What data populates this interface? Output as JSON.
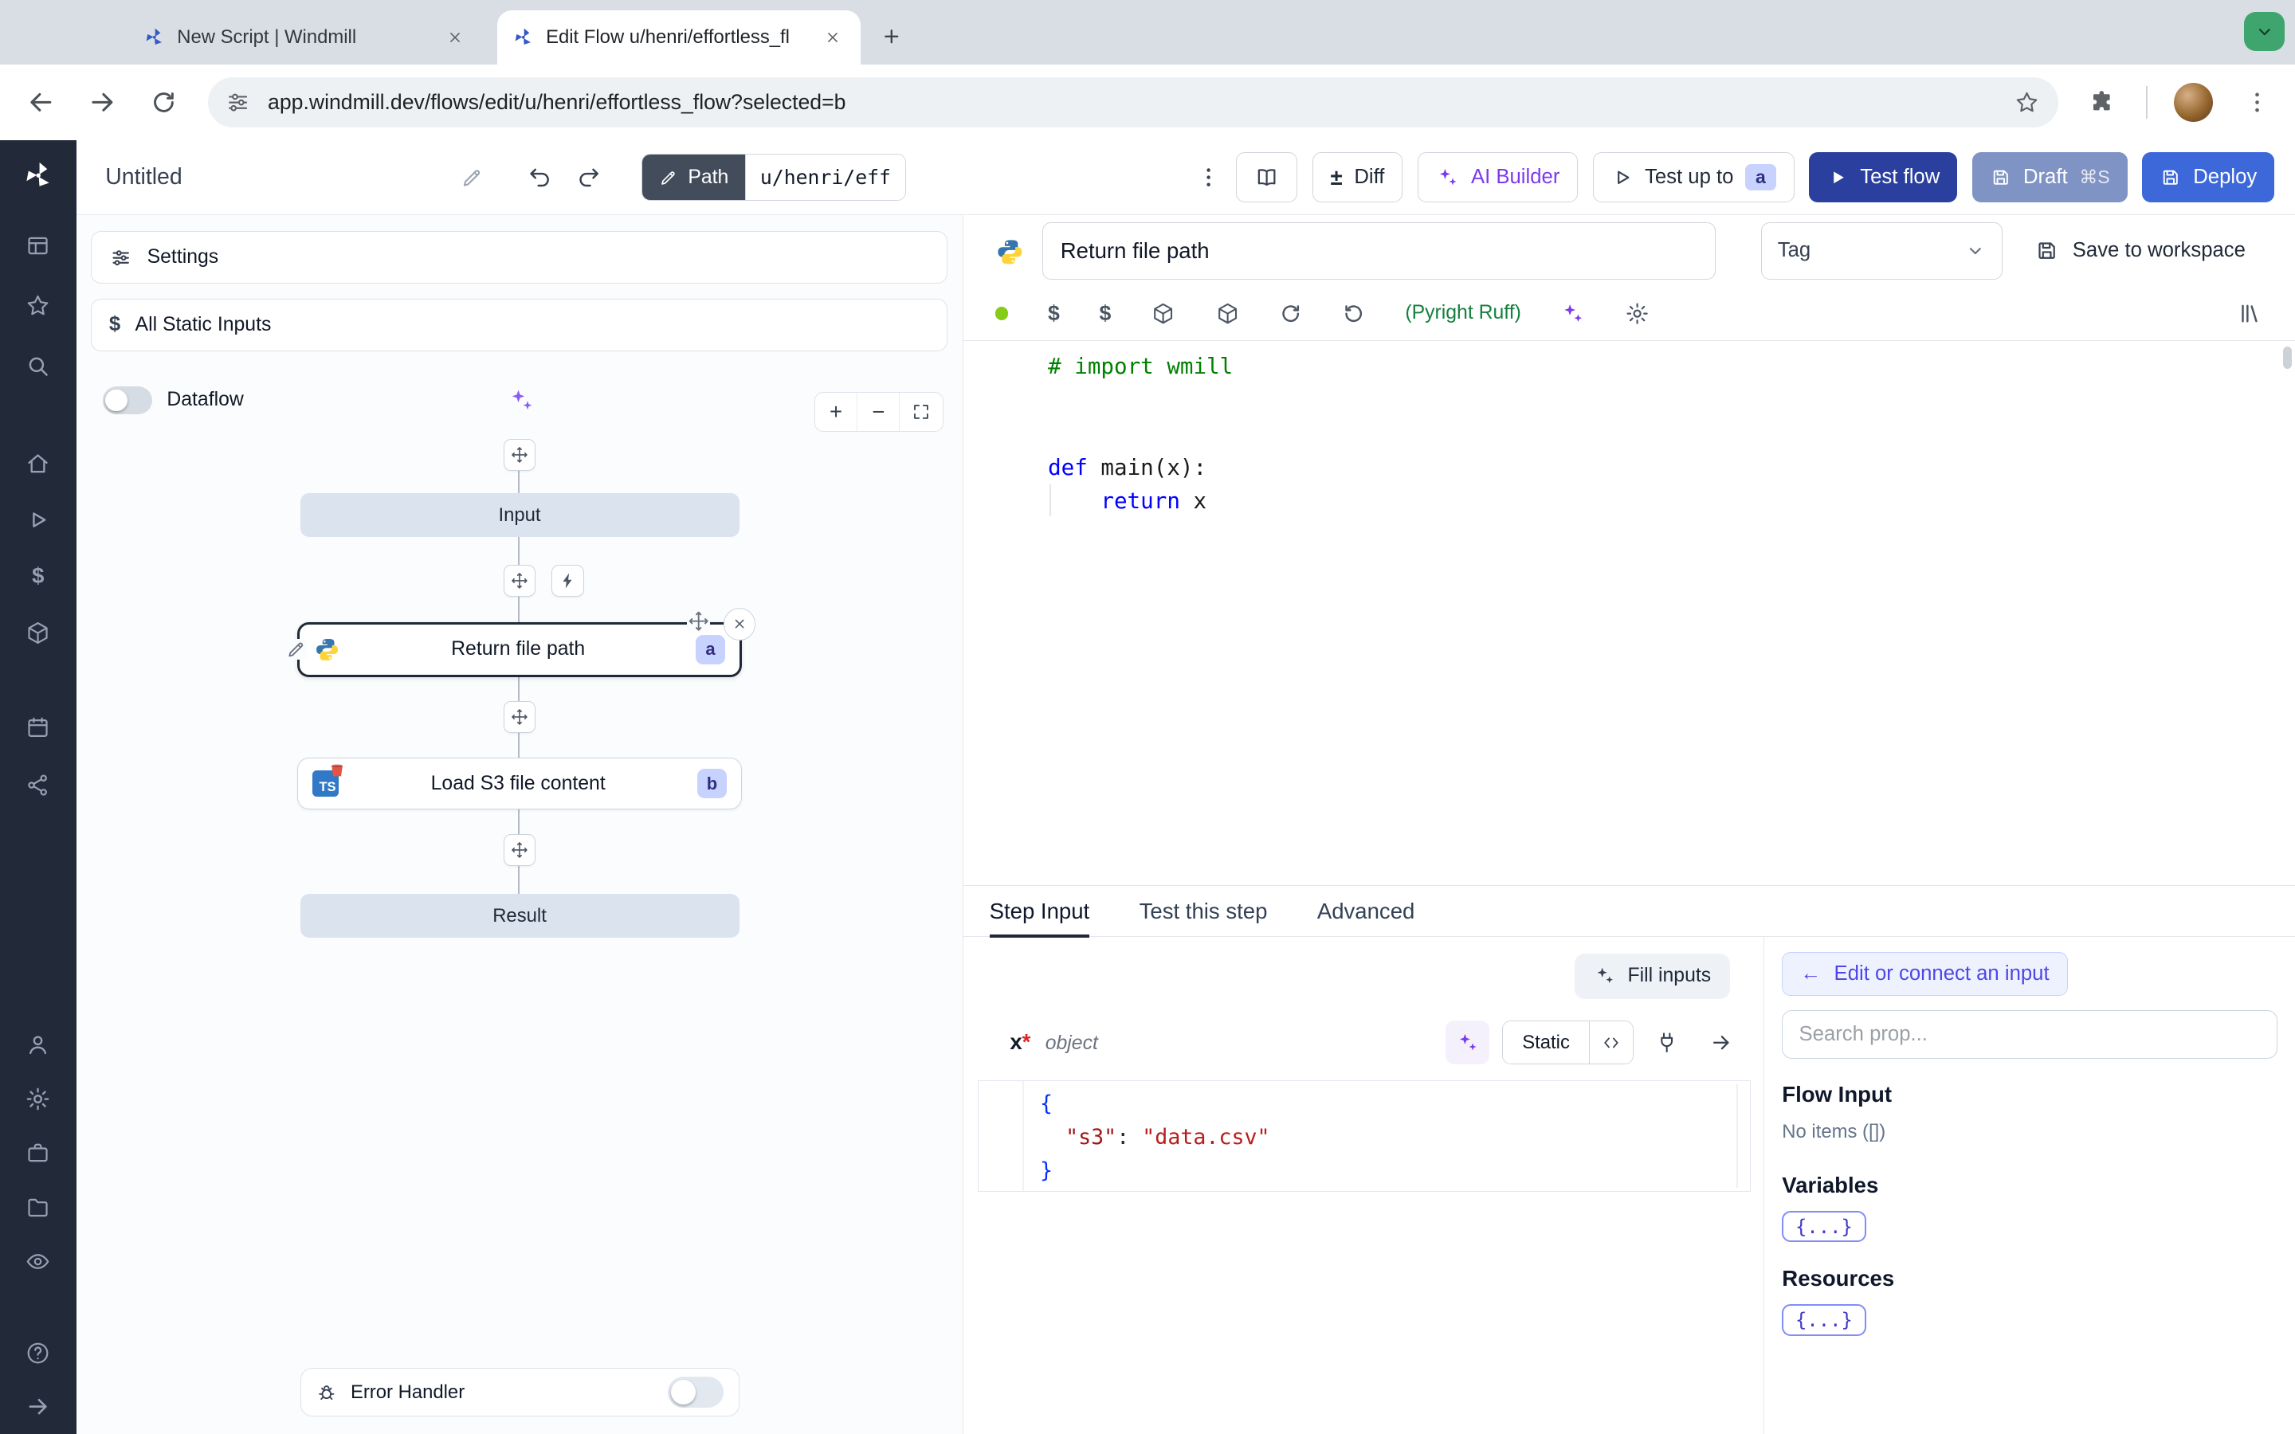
{
  "icons": {
    "dollar": "$",
    "plusminus": "±",
    "plus": "+",
    "minus": "−",
    "close": "×",
    "arrow_left": "←"
  },
  "browser": {
    "tab1": "New Script | Windmill",
    "tab2": "Edit Flow u/henri/effortless_fl",
    "url": "app.windmill.dev/flows/edit/u/henri/effortless_flow?selected=b"
  },
  "topbar": {
    "title": "Untitled",
    "path_label": "Path",
    "path_value": "u/henri/eff",
    "diff": "Diff",
    "ai_builder": "AI Builder",
    "test_up_to": "Test up to",
    "test_up_to_badge": "a",
    "test_flow": "Test flow",
    "draft": "Draft",
    "draft_shortcut": "⌘S",
    "deploy": "Deploy"
  },
  "flow": {
    "settings": "Settings",
    "all_static_inputs": "All Static Inputs",
    "dataflow": "Dataflow",
    "input_node": "Input",
    "step_a": "Return file path",
    "step_a_badge": "a",
    "step_b": "Load S3 file content",
    "step_b_badge": "b",
    "step_b_icon": "TS",
    "result_node": "Result",
    "error_handler": "Error Handler"
  },
  "step": {
    "name": "Return file path",
    "tag": "Tag",
    "save": "Save to workspace",
    "lint": "(Pyright Ruff)",
    "code": {
      "l1": "# import wmill",
      "l4_kw": "def",
      "l4_rest": " main(x):",
      "l5_kw": "return",
      "l5_rest": " x"
    },
    "tabs": {
      "a": "Step Input",
      "b": "Test this step",
      "c": "Advanced"
    },
    "fill_inputs": "Fill inputs",
    "arg_name": "x",
    "arg_req": "*",
    "arg_type": "object",
    "static": "Static",
    "json": {
      "open": "{",
      "key": "\"s3\"",
      "colon": ": ",
      "value": "\"data.csv\"",
      "close": "}"
    }
  },
  "connect": {
    "edit": "Edit or connect an input",
    "search_placeholder": "Search prop...",
    "flow_input": "Flow Input",
    "no_items": "No items ([])",
    "variables": "Variables",
    "resources": "Resources",
    "braces": "{...}"
  },
  "colors": {
    "test_flow_blue": "#2a3f9e",
    "draft_slate": "#8093c5",
    "deploy_blue": "#3d68da",
    "ai_violet": "#7c3aed",
    "lint_green": "#15803d",
    "badge_bg": "#c7d2fe",
    "badge_text": "#312e81",
    "tab_search_green": "#3fa56f",
    "sidebar_dark": "#222938"
  }
}
